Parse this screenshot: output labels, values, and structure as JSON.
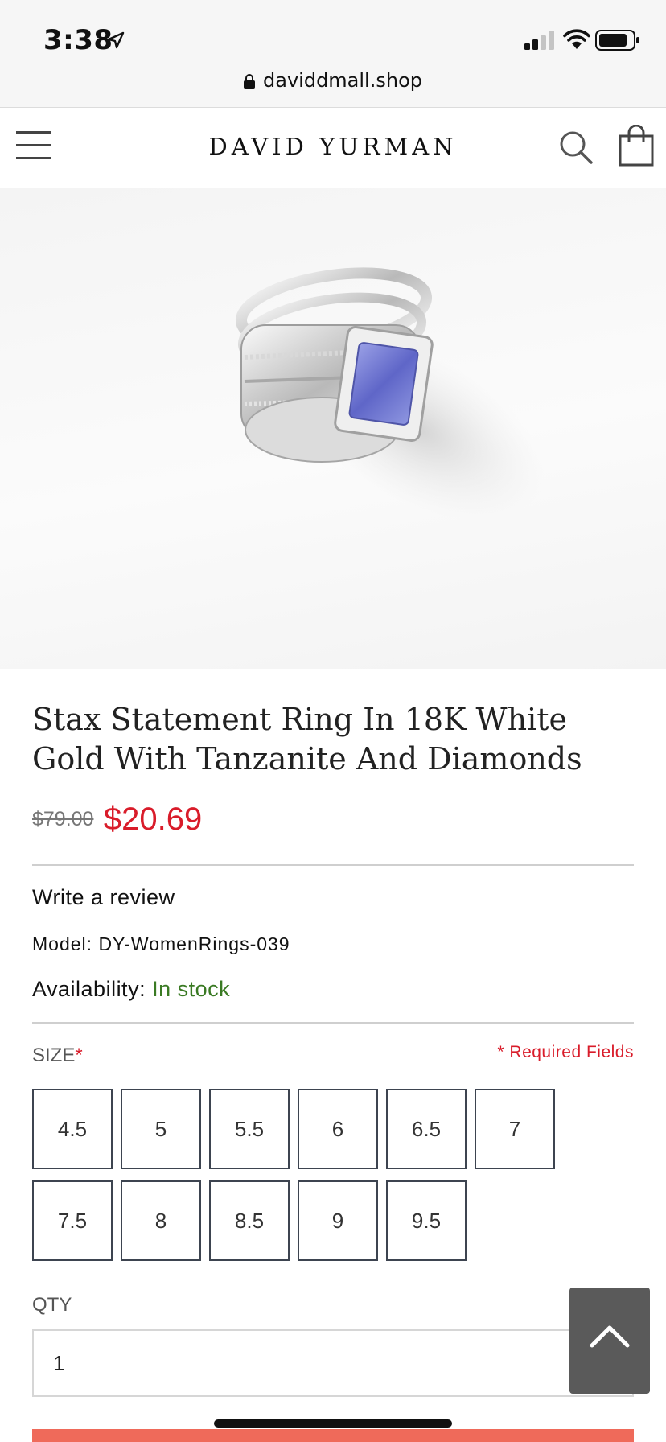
{
  "status_bar": {
    "time": "3:38",
    "url": "daviddmall.shop"
  },
  "header": {
    "brand": "DAVID YURMAN",
    "menu_icon": "hamburger-menu-icon",
    "search_icon": "search-icon",
    "cart_icon": "shopping-bag-icon"
  },
  "product": {
    "image_alt": "ring-image",
    "title": "Stax Statement Ring In 18K White Gold With Tanzanite And Diamonds",
    "old_price": "$79.00",
    "new_price": "$20.69",
    "write_review": "Write a review",
    "model_label": "Model:",
    "model_value": "DY-WomenRings-039",
    "availability_label": "Availability:",
    "availability_value": "In stock",
    "size_label": "SIZE",
    "size_required_mark": "*",
    "required_fields": "* Required Fields",
    "sizes": [
      "4.5",
      "5",
      "5.5",
      "6",
      "6.5",
      "7",
      "7.5",
      "8",
      "8.5",
      "9",
      "9.5"
    ],
    "qty_label": "QTY",
    "qty_value": "1"
  },
  "colors": {
    "sale_price": "#d91c2a",
    "in_stock": "#3a7a23",
    "add_to_cart": "#ef6a5a",
    "scroll_top_bg": "#5a5a5a"
  }
}
